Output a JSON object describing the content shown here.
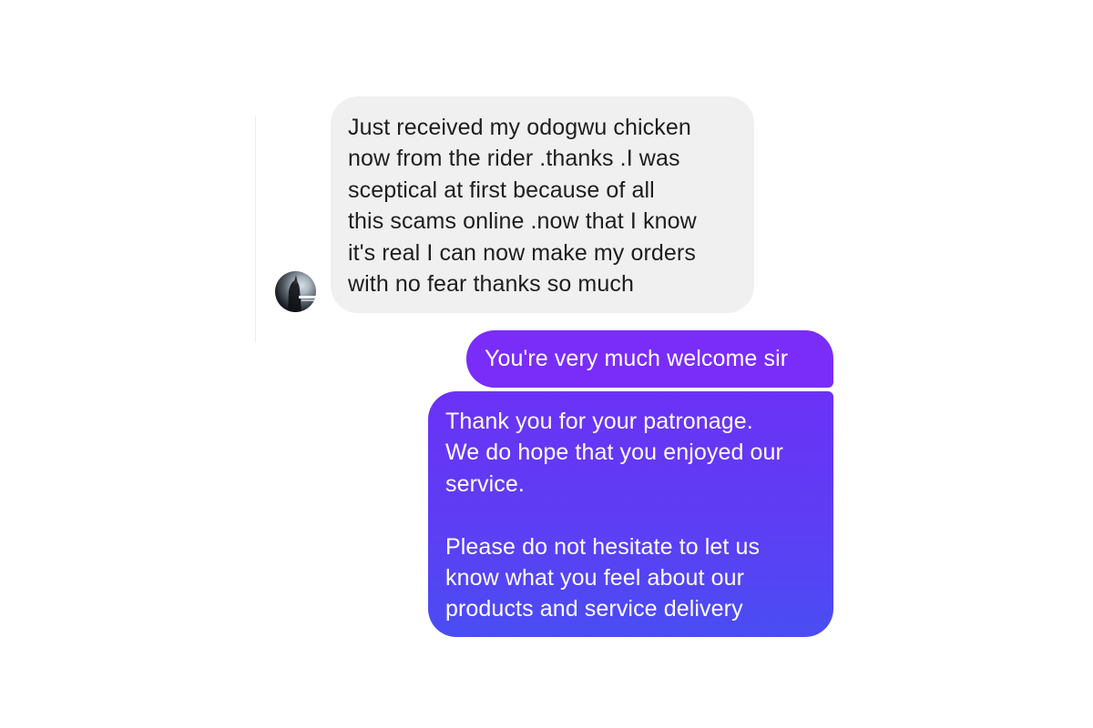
{
  "conversation": {
    "contact": {
      "avatar_icon": "contact-avatar-photo"
    },
    "messages": [
      {
        "direction": "incoming",
        "text": "Just received my odogwu chicken\nnow from the rider .thanks  .I was\nsceptical at first because of all\nthis scams online .now that I know\nit's real I can now make my orders\nwith no fear thanks so much"
      },
      {
        "direction": "outgoing",
        "text": "You're very much welcome sir"
      },
      {
        "direction": "outgoing",
        "text": "Thank you for your patronage.\nWe do hope that you enjoyed our\nservice.\n\nPlease do not hesitate to let us\nknow what you feel about our\nproducts and service delivery"
      }
    ]
  },
  "colors": {
    "incoming_bubble": "#f0f0f0",
    "outgoing_bubble": "#7a2df8",
    "outgoing_bubble_gradient_end": "#4a4df3"
  }
}
